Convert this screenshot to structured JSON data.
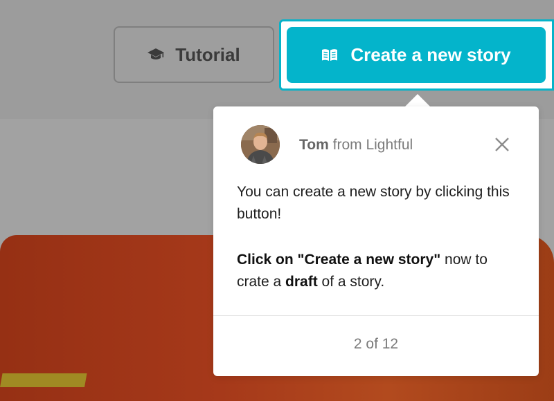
{
  "header": {
    "tutorial_label": "Tutorial",
    "tutorial_icon": "graduation-cap-icon",
    "create_label": "Create a new story",
    "create_icon": "open-book-icon",
    "accent_color": "#04b4cb"
  },
  "popover": {
    "sender_name": "Tom",
    "sender_suffix": " from Lightful",
    "line1": "You can create a new story by clicking this button!",
    "line2_bold": "Click on \"Create a new story\"",
    "line2_mid": " now to crate a ",
    "line2_bold2": "draft",
    "line2_end": " of a story.",
    "pager": "2 of 12"
  }
}
